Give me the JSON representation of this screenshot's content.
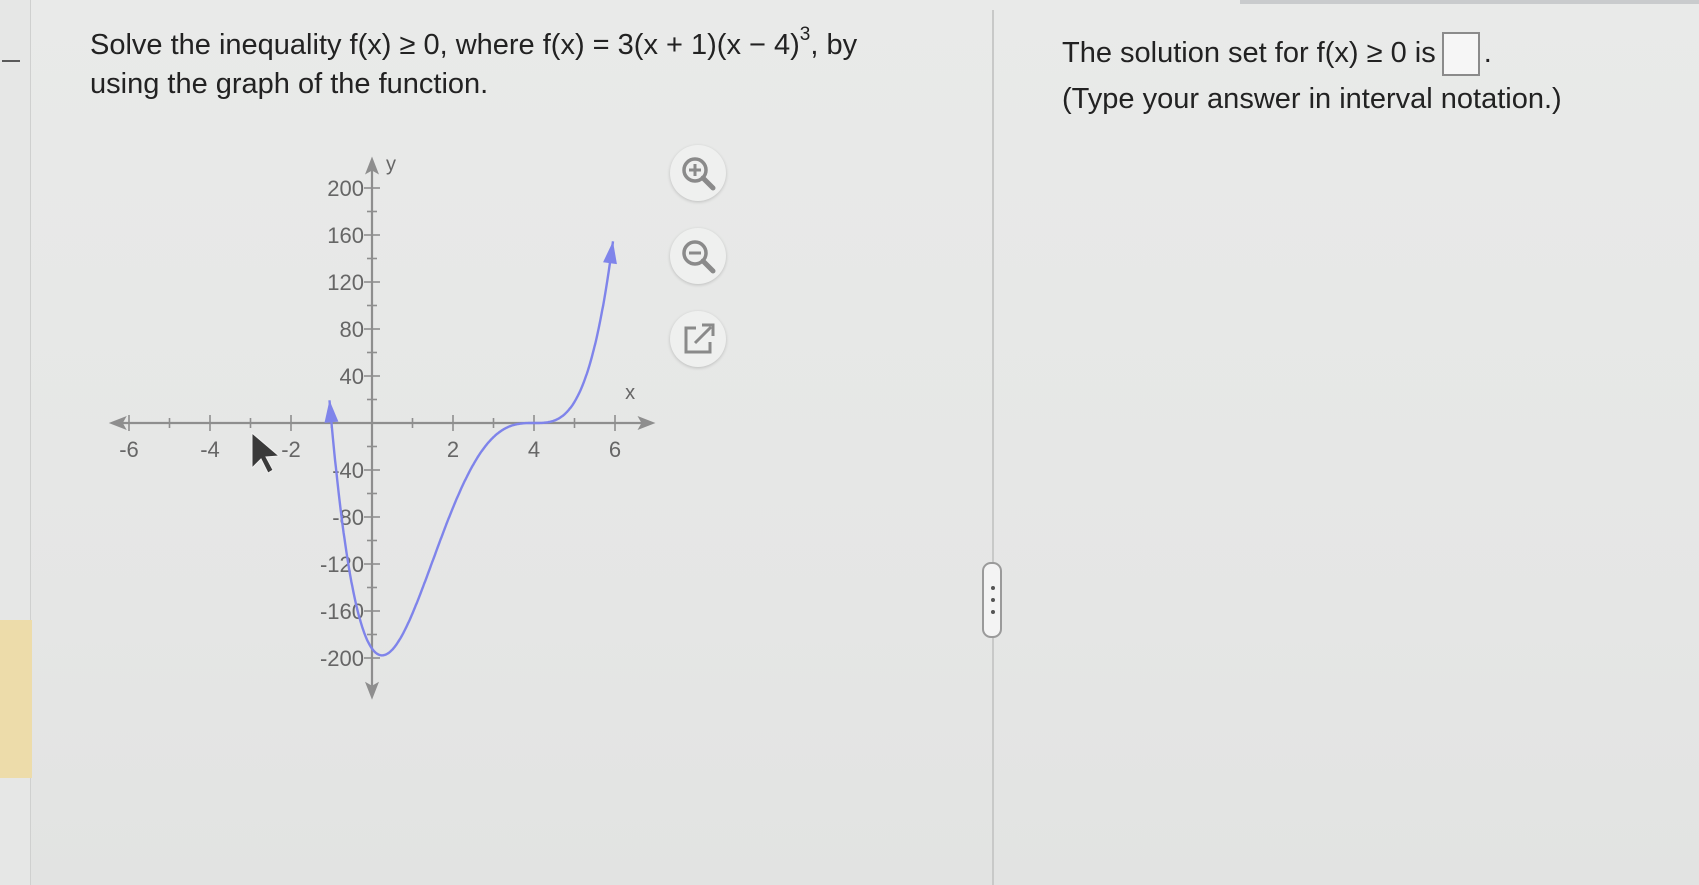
{
  "problem": {
    "line1_before": "Solve the inequality f(x) ≥ 0, where f(x) = 3(x + 1)(x − 4)",
    "exponent": "3",
    "line1_after": ", by",
    "line2": "using the graph of the function."
  },
  "answer": {
    "prompt": "The solution set for f(x) ≥ 0 is",
    "period": ".",
    "hint": "(Type your answer in interval notation.)",
    "value": ""
  },
  "tools": {
    "zoom_in": "zoom-in-icon",
    "zoom_out": "zoom-out-icon",
    "popout": "popout-icon"
  },
  "colors": {
    "curve": "#7f84ea",
    "icon": "#8a8a8a"
  },
  "chart_data": {
    "type": "line",
    "function": "3(x + 1)(x − 4)^3",
    "x_axis_label": "x",
    "y_axis_label": "y",
    "xlim": [
      -6.5,
      7
    ],
    "ylim": [
      -210,
      220
    ],
    "x_ticks": [
      -6,
      -4,
      -2,
      2,
      4,
      6
    ],
    "y_ticks": [
      200,
      160,
      120,
      80,
      40,
      -40,
      -80,
      -120,
      -160,
      -200
    ],
    "x_tick_labels": [
      "-6",
      "-4",
      "-2",
      "2",
      "4",
      "6"
    ],
    "y_tick_labels": [
      "200",
      "160",
      "120",
      "80",
      "40",
      "-40",
      "-80",
      "-120",
      "-160",
      "-200"
    ],
    "x_range_plotted": [
      -1.05,
      5.95
    ],
    "grid": false
  }
}
